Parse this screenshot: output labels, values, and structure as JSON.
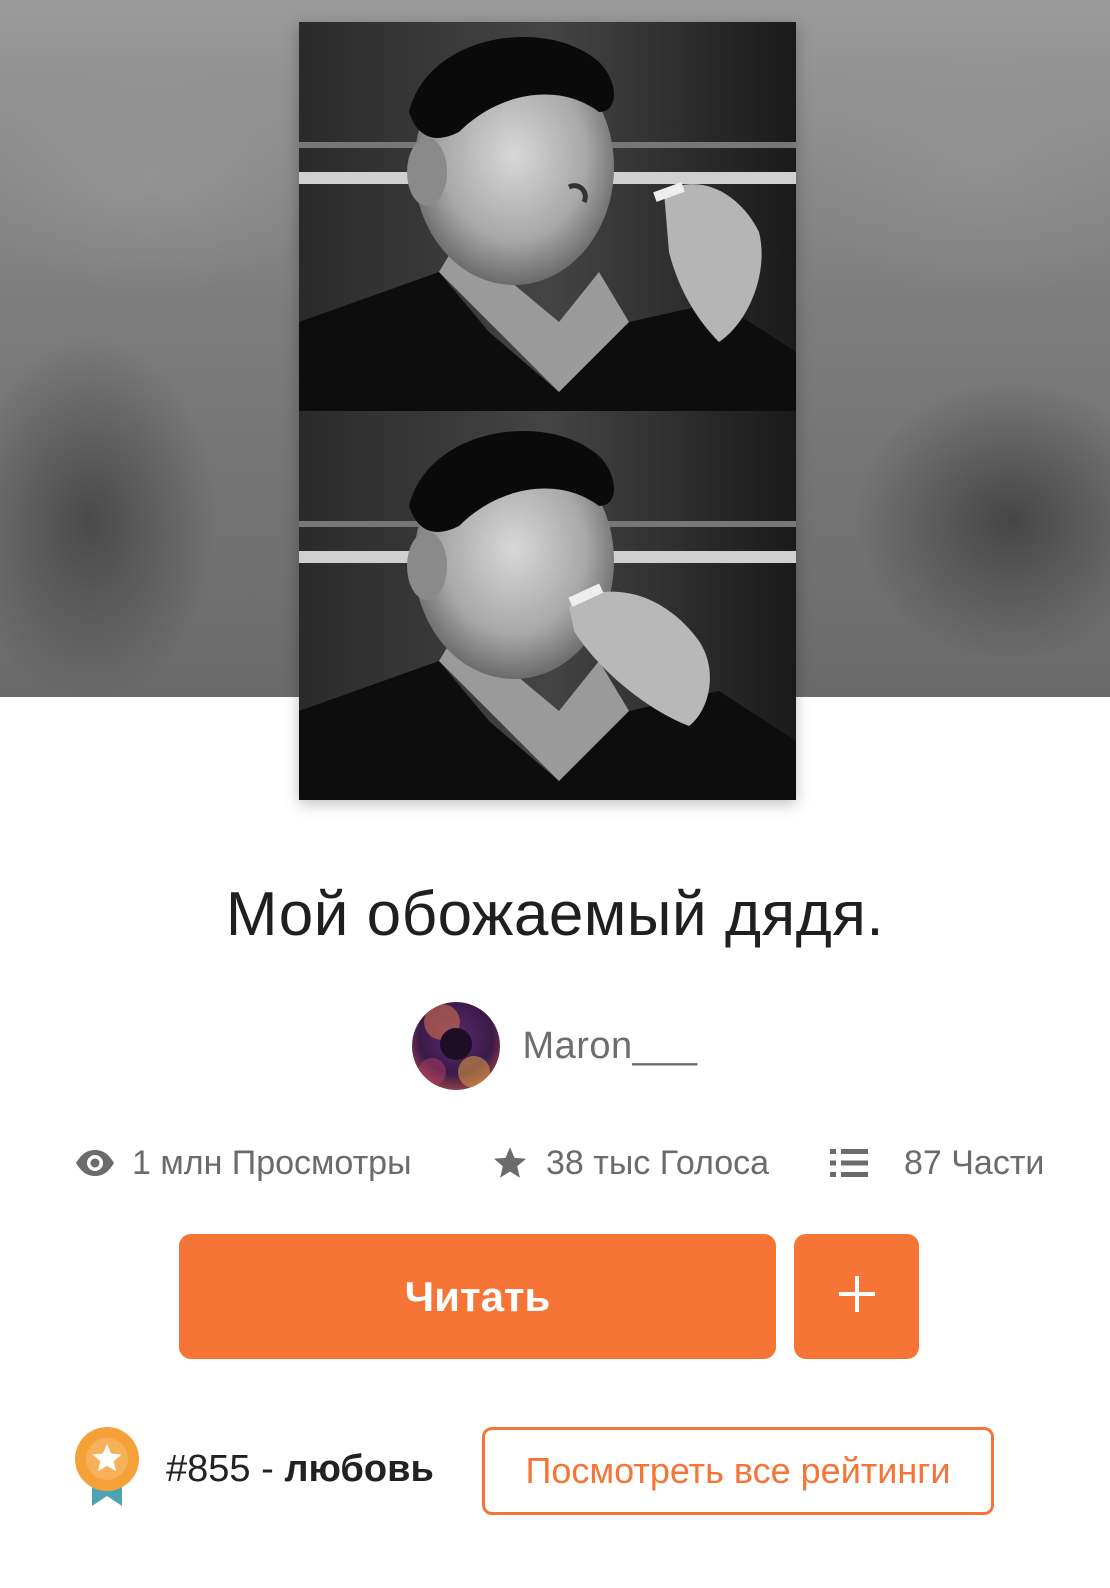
{
  "story": {
    "title": "Мой обожаемый дядя.",
    "author": "Maron___"
  },
  "stats": {
    "views": "1 млн Просмотры",
    "votes": "38 тыс Голоса",
    "parts": "87 Части"
  },
  "actions": {
    "read_label": "Читать",
    "add_label": "+"
  },
  "ranking": {
    "position": "#855",
    "separator": " - ",
    "tag": "любовь",
    "view_all_label": "Посмотреть все рейтинги"
  },
  "icons": {
    "views": "eye-icon",
    "votes": "star-icon",
    "parts": "list-icon",
    "add": "plus-icon",
    "ranking": "award-badge-icon"
  },
  "colors": {
    "accent": "#f57436",
    "badge_ribbon": "#4ba3b5",
    "badge_medal": "#f5a13a"
  }
}
